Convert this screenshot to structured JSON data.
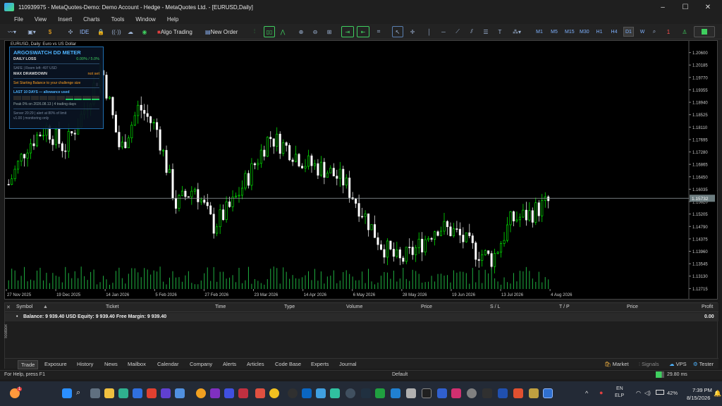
{
  "window": {
    "title": "110939975 - MetaQuotes-Demo: Demo Account - Hedge - MetaQuotes Ltd. - [EURUSD,Daily]",
    "minimize": "–",
    "maximize": "☐",
    "close": "✕"
  },
  "menu": [
    "File",
    "View",
    "Insert",
    "Charts",
    "Tools",
    "Window",
    "Help"
  ],
  "toolbar": {
    "ide_label": "IDE",
    "algo_trading": "Algo Trading",
    "new_order": "New Order",
    "timeframes": [
      "M1",
      "M5",
      "M15",
      "M30",
      "H1",
      "H4",
      "D1",
      "W"
    ],
    "active_timeframe": "D1",
    "notif_count": "1"
  },
  "chart": {
    "symbol_label": "EURUSD, Daily: Euro vs US Dollar",
    "current_price": "1.15732",
    "price_ticks": [
      "1.20600",
      "1.20185",
      "1.19770",
      "1.19355",
      "1.18940",
      "1.18525",
      "1.18110",
      "1.17695",
      "1.17280",
      "1.16865",
      "1.16450",
      "1.16035",
      "1.15620",
      "1.15205",
      "1.14790",
      "1.14375",
      "1.13960",
      "1.13545",
      "1.13130",
      "1.12715"
    ],
    "date_ticks": [
      "27 Nov 2025",
      "19 Dec 2025",
      "14 Jan 2026",
      "5 Feb 2026",
      "27 Feb 2026",
      "23 Mar 2026",
      "14 Apr 2026",
      "6 May 2026",
      "28 May 2026",
      "19 Jun 2026",
      "13 Jul 2026",
      "4 Aug 2026"
    ],
    "colors": {
      "bull": "#00ff00",
      "bear": "#ffffff",
      "bg": "#000000",
      "bidline": "#9aa4a6"
    }
  },
  "chart_data": {
    "type": "candlestick",
    "ylim": [
      1.127,
      1.2085
    ],
    "xlabel": "",
    "ylabel": "",
    "closes_approx": [
      1.162,
      1.175,
      1.181,
      1.174,
      1.186,
      1.201,
      1.173,
      1.188,
      1.18,
      1.155,
      1.161,
      1.148,
      1.155,
      1.166,
      1.178,
      1.174,
      1.169,
      1.167,
      1.163,
      1.153,
      1.142,
      1.136,
      1.141,
      1.148,
      1.146,
      1.14,
      1.137,
      1.15,
      1.152,
      1.156
    ]
  },
  "indicator": {
    "title": "ARGOSWATCH DD METER",
    "daily_loss_label": "DAILY LOSS",
    "daily_loss_value": "0.00% / 5.0%",
    "safe_text": "SAFE | Room left: 497 USD",
    "max_dd_label": "MAX DRAWDOWN",
    "max_dd_value": "not set",
    "hint": "Set Starting Balance to your challenge size",
    "last_days_label": "LAST 10 DAYS — allowance used",
    "peak_text": "Peak 0% on 2026.08.13 | 4 trading days",
    "server_text": "Server 20:29 | alert at 80% of limit",
    "version_text": "v1.00 | monitoring only"
  },
  "toolbox": {
    "columns": [
      "Symbol",
      "Ticket",
      "Time",
      "Type",
      "Volume",
      "Price",
      "S / L",
      "T / P",
      "Price",
      "Profit"
    ],
    "balance_line": "Balance: 9 939.40 USD  Equity: 9 939.40  Free Margin: 9 939.40",
    "profit": "0.00",
    "tabs": [
      "Trade",
      "Exposure",
      "History",
      "News",
      "Mailbox",
      "Calendar",
      "Company",
      "Alerts",
      "Articles",
      "Code Base",
      "Experts",
      "Journal"
    ],
    "active_tab": "Trade",
    "side_label": "Toolbox",
    "right_items": [
      "Market",
      "Signals",
      "VPS",
      "Tester"
    ]
  },
  "status": {
    "help": "For Help, press F1",
    "profile": "Default",
    "ping": "29.80 ms"
  },
  "taskbar": {
    "lang_top": "EN",
    "lang_bottom": "ELP",
    "battery": "42%",
    "time": "7:39 PM",
    "date": "8/15/2026",
    "badge": "1"
  }
}
